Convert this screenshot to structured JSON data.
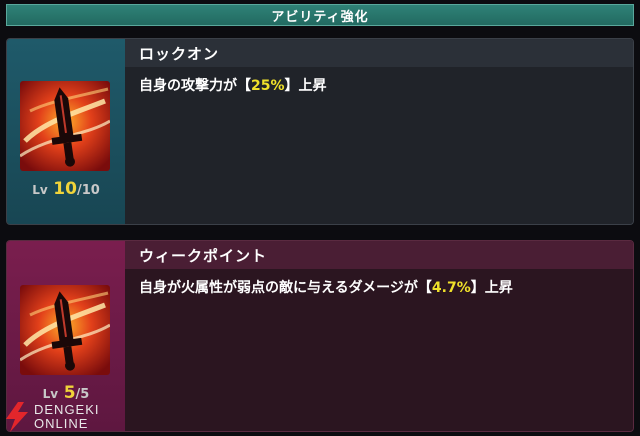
{
  "header": {
    "title": "アビリティ強化"
  },
  "abilities": [
    {
      "name": "ロックオン",
      "desc_before": "自身の攻撃力が【",
      "value": "25%",
      "desc_after": "】上昇",
      "level": {
        "prefix": "Lv",
        "current": "10",
        "sep": "/",
        "max": "10"
      },
      "icon": "sword-skill-icon"
    },
    {
      "name": "ウィークポイント",
      "desc_before": "自身が火属性が弱点の敵に与えるダメージが【",
      "value": "4.7%",
      "desc_after": "】上昇",
      "level": {
        "prefix": "Lv",
        "current": "5",
        "sep": "/",
        "max": "5"
      },
      "icon": "sword-skill-icon"
    }
  ],
  "watermark": {
    "line1": "DENGEKI",
    "line2": "ONLINE"
  },
  "colors": {
    "accent_value": "#f0e12a",
    "header_bg": "#2a766c",
    "card1_side": "#1f5a6a",
    "card2_side": "#7a1e4e"
  }
}
